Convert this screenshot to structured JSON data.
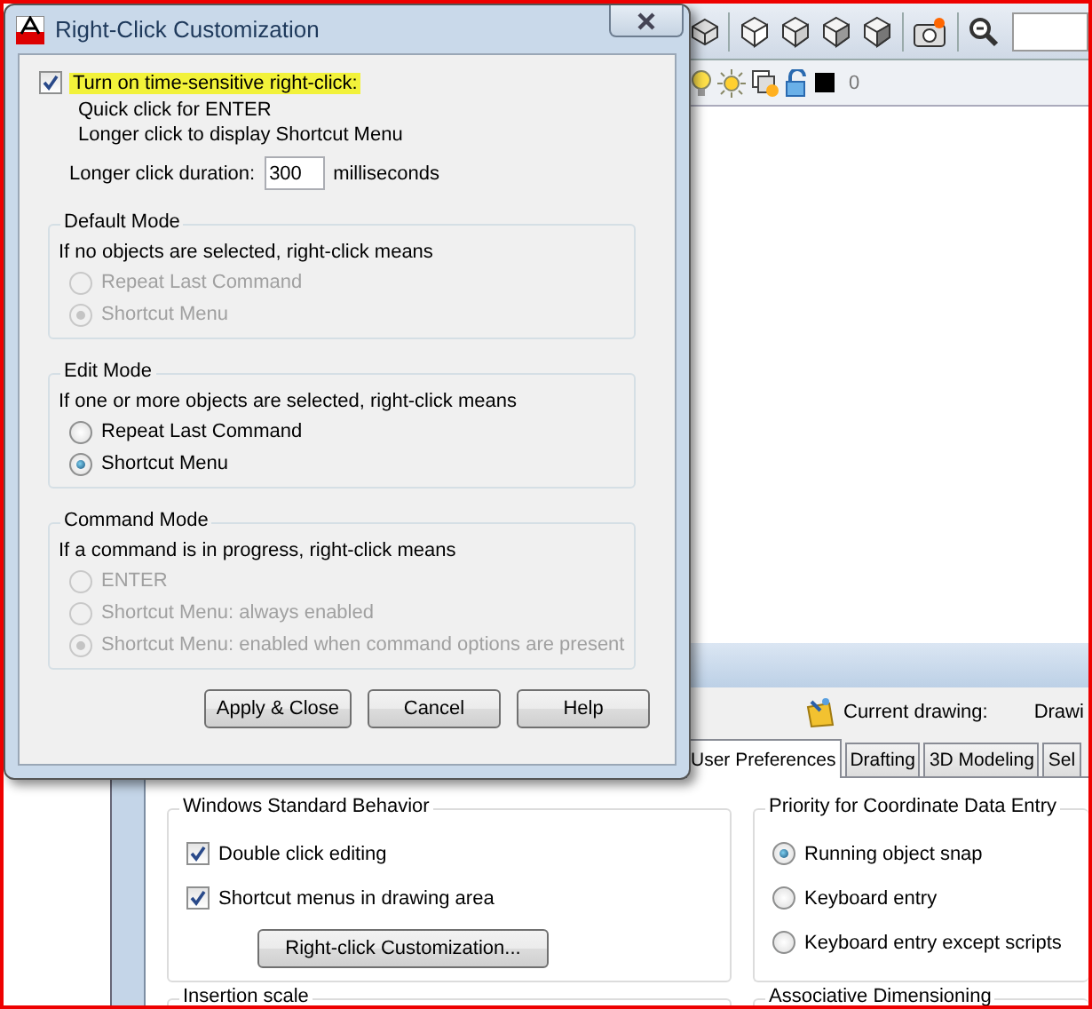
{
  "app": {
    "layer_name": "0"
  },
  "options_dialog": {
    "current_drawing_label": "Current drawing:",
    "current_drawing_value": "Drawi",
    "tabs": [
      {
        "label": "User Preferences",
        "selected": true
      },
      {
        "label": "Drafting",
        "selected": false
      },
      {
        "label": "3D Modeling",
        "selected": false
      },
      {
        "label": "Sel",
        "selected": false
      }
    ],
    "groups": [
      {
        "title": "Windows Standard Behavior",
        "items": [
          {
            "kind": "checkbox",
            "label": "Double click editing",
            "checked": true
          },
          {
            "kind": "checkbox",
            "label": "Shortcut menus in drawing area",
            "checked": true
          },
          {
            "kind": "button",
            "label": "Right-click Customization..."
          }
        ]
      },
      {
        "title": "Priority for Coordinate Data Entry",
        "items": [
          {
            "kind": "radio",
            "label": "Running object snap",
            "selected": true
          },
          {
            "kind": "radio",
            "label": "Keyboard entry",
            "selected": false
          },
          {
            "kind": "radio",
            "label": "Keyboard entry except scripts",
            "selected": false
          }
        ]
      }
    ],
    "lower_groups": [
      "Insertion scale",
      "Associative Dimensioning"
    ]
  },
  "dialog": {
    "title": "Right-Click Customization",
    "time_sensitive": {
      "label": "Turn on time-sensitive right-click:",
      "checked": true,
      "highlighted": true
    },
    "notes": [
      "Quick click for ENTER",
      "Longer click to display Shortcut Menu"
    ],
    "duration": {
      "label": "Longer click duration:",
      "value": "300",
      "unit": "milliseconds"
    },
    "groups": [
      {
        "title": "Default Mode",
        "subtitle": "If no objects are selected, right-click means",
        "disabled": true,
        "options": [
          {
            "label": "Repeat Last Command",
            "selected": false
          },
          {
            "label": "Shortcut Menu",
            "selected": true
          }
        ]
      },
      {
        "title": "Edit Mode",
        "subtitle": "If one or more objects are selected, right-click means",
        "disabled": false,
        "options": [
          {
            "label": "Repeat Last Command",
            "selected": false
          },
          {
            "label": "Shortcut Menu",
            "selected": true
          }
        ]
      },
      {
        "title": "Command Mode",
        "subtitle": "If a command is in progress, right-click means",
        "disabled": true,
        "options": [
          {
            "label": "ENTER",
            "selected": false
          },
          {
            "label": "Shortcut Menu: always enabled",
            "selected": false
          },
          {
            "label": "Shortcut Menu: enabled when command options are present",
            "selected": true
          }
        ]
      }
    ],
    "buttons": [
      "Apply & Close",
      "Cancel",
      "Help"
    ]
  }
}
